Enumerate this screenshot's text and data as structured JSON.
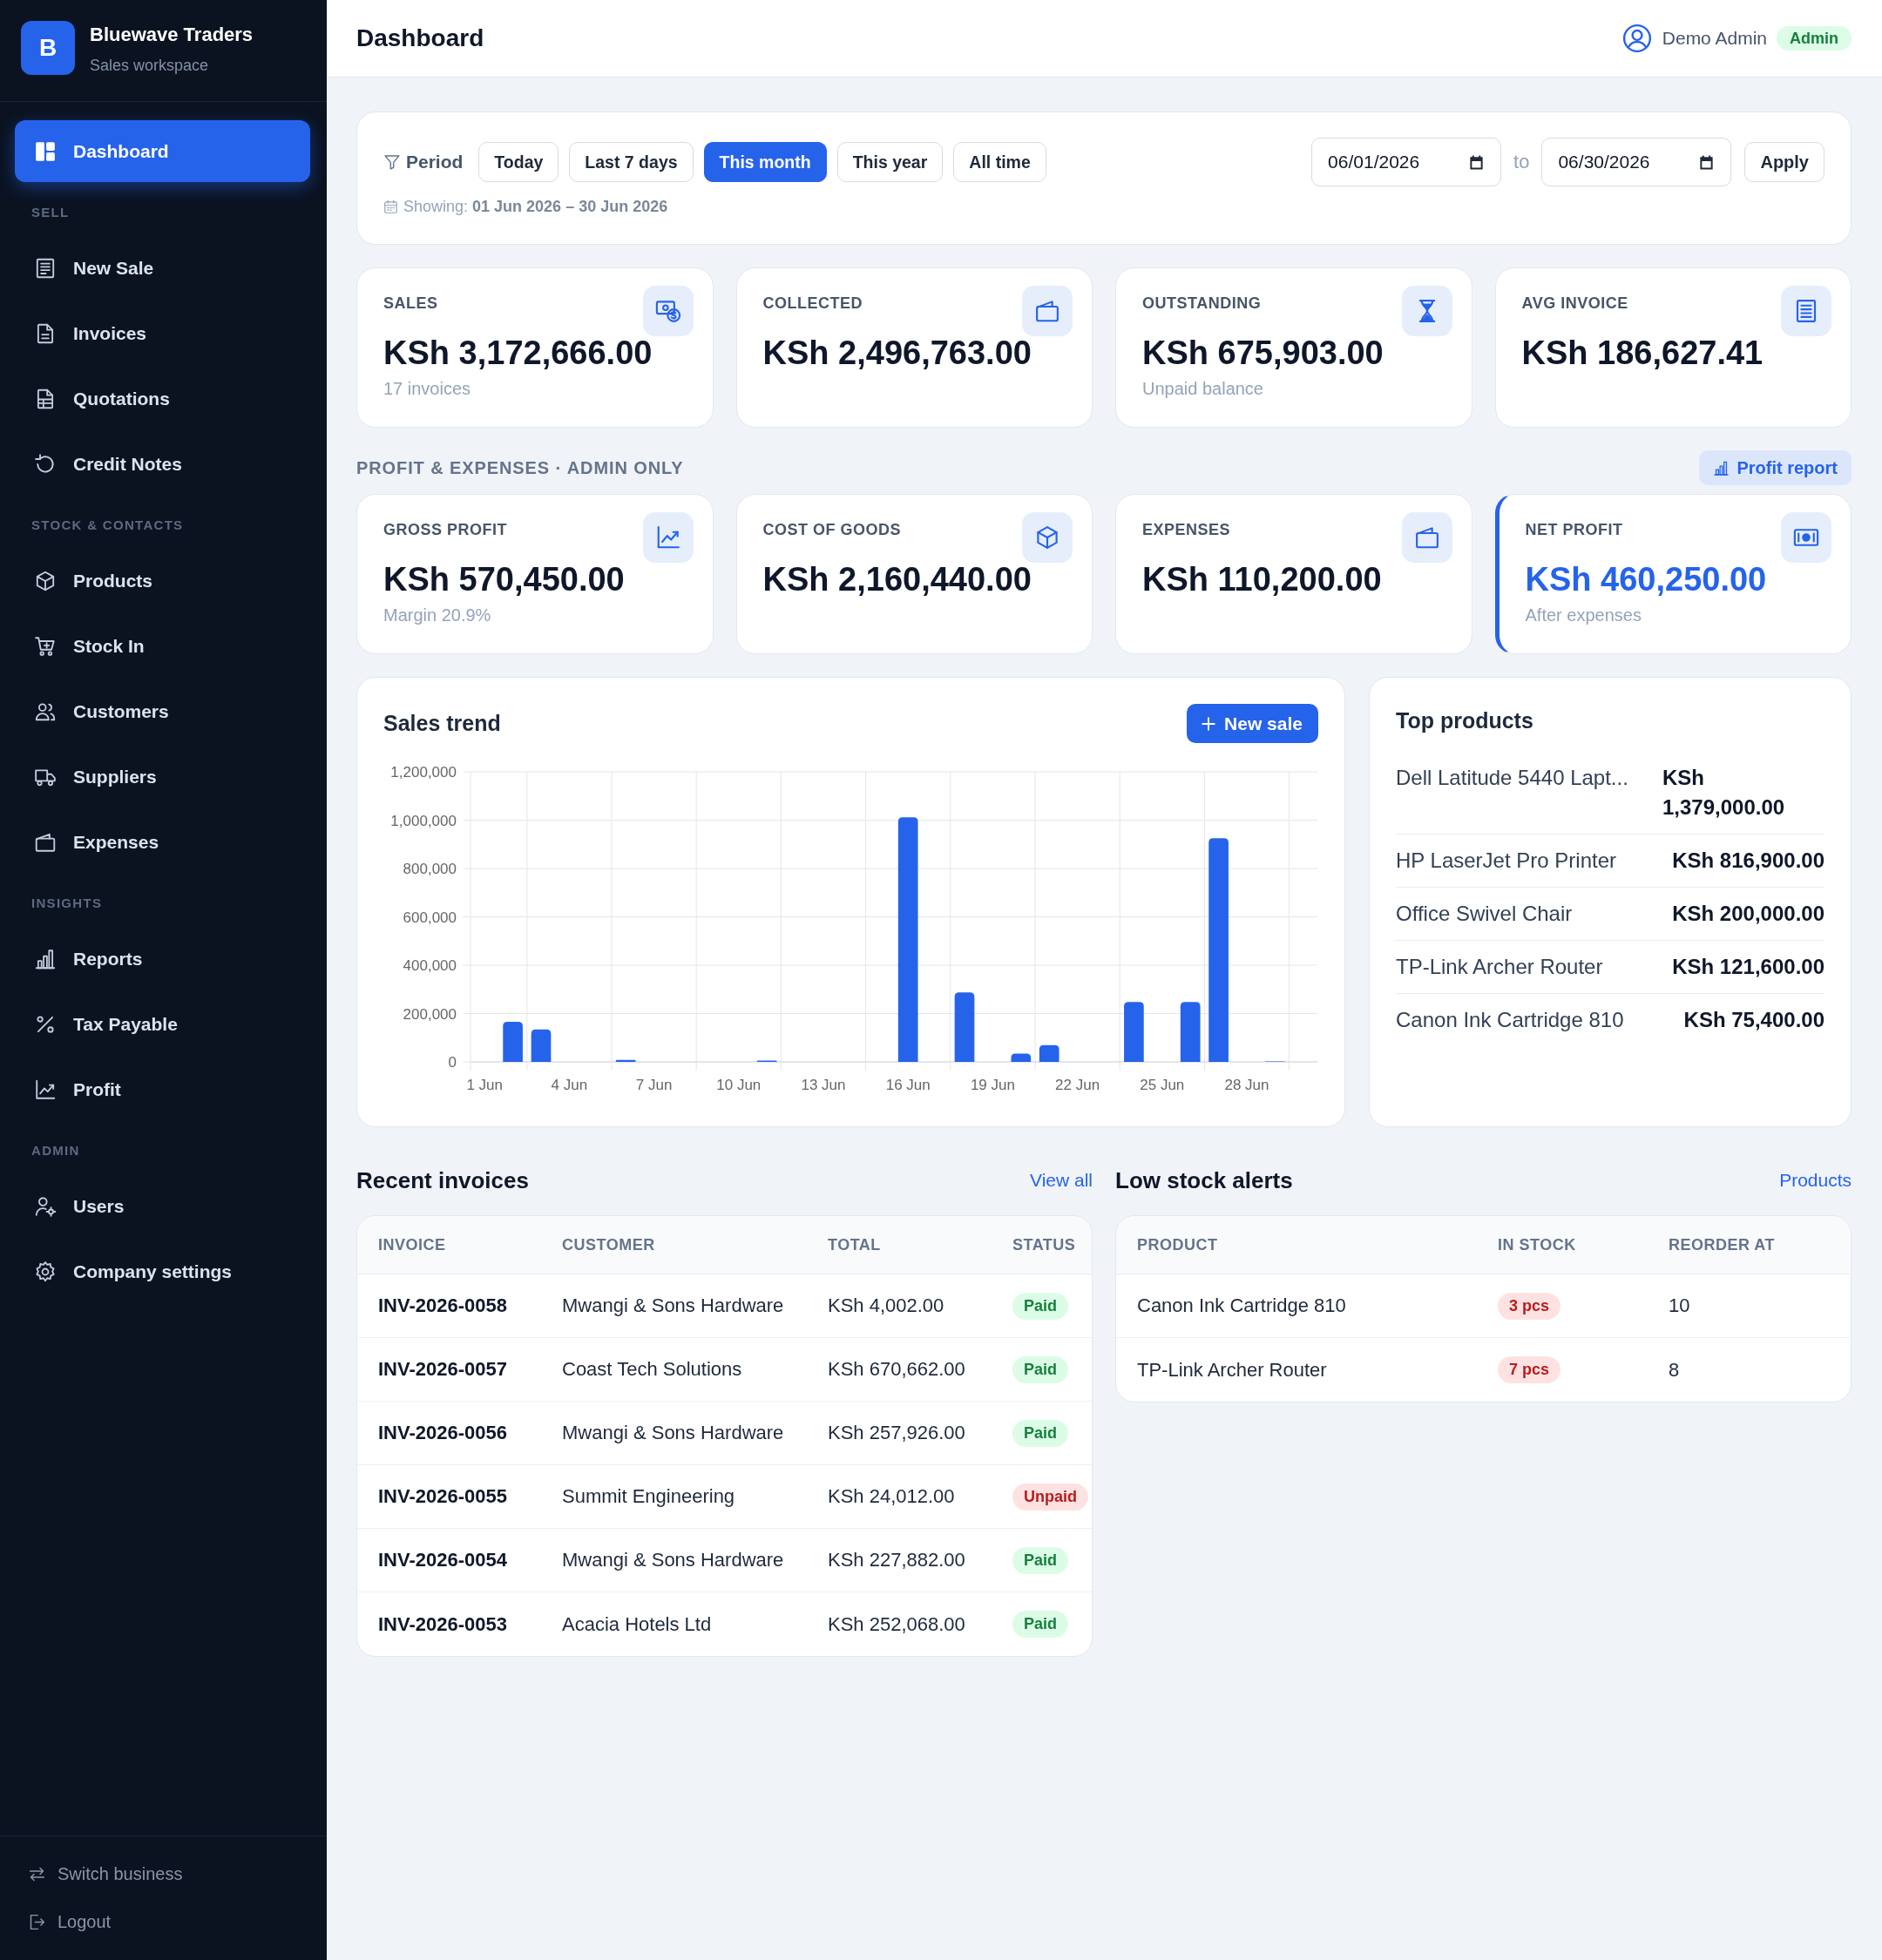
{
  "sidebar": {
    "brand": {
      "initial": "B",
      "name": "Bluewave Traders",
      "subtitle": "Sales workspace"
    },
    "groups": [
      {
        "items": [
          {
            "label": "Dashboard",
            "selected": true
          }
        ]
      },
      {
        "title": "SELL",
        "items": [
          {
            "label": "New Sale",
            "selected": false
          },
          {
            "label": "Invoices",
            "selected": false
          },
          {
            "label": "Quotations",
            "selected": false
          },
          {
            "label": "Credit Notes",
            "selected": false
          }
        ]
      },
      {
        "title": "STOCK & CONTACTS",
        "items": [
          {
            "label": "Products",
            "selected": false
          },
          {
            "label": "Stock In",
            "selected": false
          },
          {
            "label": "Customers",
            "selected": false
          },
          {
            "label": "Suppliers",
            "selected": false
          },
          {
            "label": "Expenses",
            "selected": false
          }
        ]
      },
      {
        "title": "INSIGHTS",
        "items": [
          {
            "label": "Reports",
            "selected": false
          },
          {
            "label": "Tax Payable",
            "selected": false
          },
          {
            "label": "Profit",
            "selected": false
          }
        ]
      },
      {
        "title": "ADMIN",
        "items": [
          {
            "label": "Users",
            "selected": false
          },
          {
            "label": "Company settings",
            "selected": false
          }
        ]
      }
    ],
    "footer": [
      {
        "label": "Switch business"
      },
      {
        "label": "Logout"
      }
    ]
  },
  "header": {
    "title": "Dashboard",
    "user": "Demo Admin",
    "role": "Admin"
  },
  "filter": {
    "label": "Period",
    "presets": [
      {
        "label": "Today",
        "selected": false
      },
      {
        "label": "Last 7 days",
        "selected": false
      },
      {
        "label": "This month",
        "selected": true
      },
      {
        "label": "This year",
        "selected": false
      },
      {
        "label": "All time",
        "selected": false
      }
    ],
    "from": "06/01/2026",
    "separator": "to",
    "to": "06/30/2026",
    "apply": "Apply",
    "showing": "Showing: **01 Jun 2026 – 30 Jun 2026**"
  },
  "stats": [
    {
      "label": "SALES",
      "value": "KSh 3,172,666.00",
      "note": "17 invoices"
    },
    {
      "label": "COLLECTED",
      "value": "KSh 2,496,763.00"
    },
    {
      "label": "OUTSTANDING",
      "value": "KSh 675,903.00",
      "note": "Unpaid balance"
    },
    {
      "label": "AVG INVOICE",
      "value": "KSh 186,627.41"
    }
  ],
  "profit": {
    "title": "PROFIT & EXPENSES · ADMIN ONLY",
    "action": "Profit report",
    "cards": [
      {
        "label": "GROSS PROFIT",
        "value": "KSh 570,450.00",
        "note": "Margin 20.9%",
        "highlighted": false
      },
      {
        "label": "COST OF GOODS",
        "value": "KSh 2,160,440.00",
        "highlighted": false
      },
      {
        "label": "EXPENSES",
        "value": "KSh 110,200.00",
        "highlighted": false
      },
      {
        "label": "NET PROFIT",
        "value": "KSh 460,250.00",
        "note": "After expenses",
        "highlighted": true
      }
    ]
  },
  "sales_trend": {
    "title": "Sales trend",
    "action": "New sale",
    "chart_data": {
      "type": "bar",
      "categories": [
        "1 Jun",
        null,
        null,
        "4 Jun",
        null,
        null,
        "7 Jun",
        null,
        null,
        "10 Jun",
        null,
        null,
        "13 Jun",
        null,
        null,
        "16 Jun",
        null,
        null,
        "19 Jun",
        null,
        null,
        "22 Jun",
        null,
        null,
        "25 Jun",
        null,
        null,
        "28 Jun",
        null,
        null
      ],
      "series": [
        {
          "color": "#2563eb",
          "values": [
            0,
            166000,
            134000,
            0,
            0,
            8000,
            0,
            0,
            0,
            0,
            5000,
            0,
            0,
            0,
            0,
            1012000,
            0,
            287000,
            0,
            34000,
            69000,
            0,
            0,
            248000,
            0,
            248000,
            925000,
            0,
            2000,
            0
          ]
        }
      ],
      "ylim": [
        0,
        1200000
      ],
      "yticks": [
        {
          "value": 0,
          "label": "0"
        },
        {
          "value": 200000,
          "label": "200,000"
        },
        {
          "value": 400000,
          "label": "400,000"
        },
        {
          "value": 600000,
          "label": "600,000"
        },
        {
          "value": 800000,
          "label": "800,000"
        },
        {
          "value": 1000000,
          "label": "1,000,000"
        },
        {
          "value": 1200000,
          "label": "1,200,000"
        }
      ],
      "grid": true
    }
  },
  "top_products": {
    "title": "Top products",
    "items": [
      {
        "name": "Dell Latitude 5440 Lapt...",
        "amount": "KSh 1,379,000.00"
      },
      {
        "name": "HP LaserJet Pro Printer",
        "amount": "KSh 816,900.00"
      },
      {
        "name": "Office Swivel Chair",
        "amount": "KSh 200,000.00"
      },
      {
        "name": "TP-Link Archer Router",
        "amount": "KSh 121,600.00"
      },
      {
        "name": "Canon Ink Cartridge 810",
        "amount": "KSh 75,400.00"
      }
    ]
  },
  "recent_invoices": {
    "title": "Recent invoices",
    "link": "View all",
    "columns": [
      "INVOICE",
      "CUSTOMER",
      "TOTAL",
      "STATUS"
    ],
    "rows": [
      {
        "invoice": "INV-2026-0058",
        "customer": "Mwangi & Sons Hardware",
        "total": "KSh 4,002.00",
        "status": "Paid",
        "paid": true
      },
      {
        "invoice": "INV-2026-0057",
        "customer": "Coast Tech Solutions",
        "total": "KSh 670,662.00",
        "status": "Paid",
        "paid": true
      },
      {
        "invoice": "INV-2026-0056",
        "customer": "Mwangi & Sons Hardware",
        "total": "KSh 257,926.00",
        "status": "Paid",
        "paid": true
      },
      {
        "invoice": "INV-2026-0055",
        "customer": "Summit Engineering",
        "total": "KSh 24,012.00",
        "status": "Unpaid",
        "paid": false
      },
      {
        "invoice": "INV-2026-0054",
        "customer": "Mwangi & Sons Hardware",
        "total": "KSh 227,882.00",
        "status": "Paid",
        "paid": true
      },
      {
        "invoice": "INV-2026-0053",
        "customer": "Acacia Hotels Ltd",
        "total": "KSh 252,068.00",
        "status": "Paid",
        "paid": true
      }
    ]
  },
  "low_stock": {
    "title": "Low stock alerts",
    "link": "Products",
    "columns": [
      "PRODUCT",
      "IN STOCK",
      "REORDER AT"
    ],
    "rows": [
      {
        "product": "Canon Ink Cartridge 810",
        "in_stock": "3 pcs",
        "reorder_at": "10"
      },
      {
        "product": "TP-Link Archer Router",
        "in_stock": "7 pcs",
        "reorder_at": "8"
      }
    ]
  }
}
